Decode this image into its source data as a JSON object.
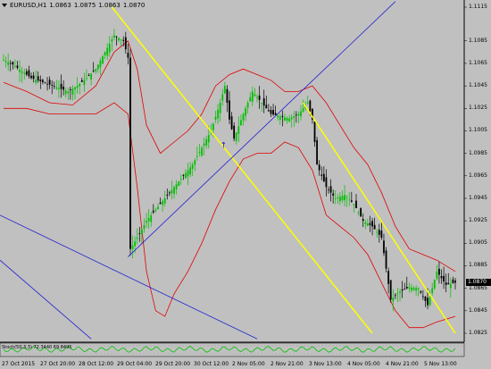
{
  "header": {
    "symbol": "EURUSD,H1",
    "open": "1.0863",
    "high": "1.0875",
    "low": "1.0863",
    "close": "1.0870"
  },
  "current_price": "1.0870",
  "oscillator_label": "Stoch(50,3,3) 72.3440 69.8495",
  "colors": {
    "background": "#c0c0c0",
    "bull": "#00c000",
    "bear": "#000000",
    "band": "#e00000",
    "trend_yellow": "#ffff00",
    "trend_blue": "#2020d0"
  },
  "chart_data": {
    "type": "candlestick",
    "ylim": [
      1.0825,
      1.1115
    ],
    "y_ticks": [
      "1.1115",
      "1.1085",
      "1.1065",
      "1.1045",
      "1.1025",
      "1.1005",
      "1.0985",
      "1.0965",
      "1.0945",
      "1.0925",
      "1.0905",
      "1.0885",
      "1.0865",
      "1.0845",
      "1.0825"
    ],
    "x_ticks": [
      "27 Oct 2015",
      "27 Oct 20:00",
      "28 Oct 12:00",
      "29 Oct 04:00",
      "29 Oct 20:00",
      "30 Oct 12:00",
      "2 Nov 05:00",
      "2 Nov 21:00",
      "3 Nov 13:00",
      "4 Nov 05:00",
      "4 Nov 21:00",
      "5 Nov 13:00"
    ],
    "close_path": [
      [
        0,
        1.1068
      ],
      [
        4,
        1.1064
      ],
      [
        8,
        1.1058
      ],
      [
        12,
        1.1052
      ],
      [
        16,
        1.1049
      ],
      [
        20,
        1.1046
      ],
      [
        24,
        1.1043
      ],
      [
        28,
        1.104
      ],
      [
        32,
        1.1045
      ],
      [
        36,
        1.1052
      ],
      [
        40,
        1.106
      ],
      [
        44,
        1.1075
      ],
      [
        48,
        1.109
      ],
      [
        52,
        1.1085
      ],
      [
        54,
        1.107
      ],
      [
        55,
        1.09
      ],
      [
        58,
        1.091
      ],
      [
        62,
        1.0925
      ],
      [
        66,
        1.0935
      ],
      [
        70,
        1.0945
      ],
      [
        74,
        1.0955
      ],
      [
        78,
        1.0965
      ],
      [
        82,
        1.0975
      ],
      [
        86,
        1.099
      ],
      [
        90,
        1.1005
      ],
      [
        94,
        1.103
      ],
      [
        96,
        1.1045
      ],
      [
        98,
        1.1015
      ],
      [
        100,
        1.0998
      ],
      [
        104,
        1.102
      ],
      [
        108,
        1.104
      ],
      [
        112,
        1.103
      ],
      [
        116,
        1.102
      ],
      [
        120,
        1.1018
      ],
      [
        124,
        1.1016
      ],
      [
        128,
        1.102
      ],
      [
        132,
        1.103
      ],
      [
        134,
        1.1015
      ],
      [
        136,
        1.0975
      ],
      [
        140,
        1.0955
      ],
      [
        144,
        1.0945
      ],
      [
        148,
        1.0948
      ],
      [
        152,
        1.094
      ],
      [
        156,
        1.0925
      ],
      [
        160,
        1.092
      ],
      [
        164,
        1.091
      ],
      [
        168,
        1.0855
      ],
      [
        172,
        1.0862
      ],
      [
        176,
        1.0866
      ],
      [
        180,
        1.0865
      ],
      [
        184,
        1.085
      ],
      [
        188,
        1.088
      ],
      [
        192,
        1.0868
      ],
      [
        196,
        1.087
      ]
    ],
    "upper_band": [
      [
        0,
        1.1048
      ],
      [
        10,
        1.104
      ],
      [
        20,
        1.103
      ],
      [
        30,
        1.1028
      ],
      [
        40,
        1.1045
      ],
      [
        48,
        1.1075
      ],
      [
        54,
        1.1085
      ],
      [
        58,
        1.106
      ],
      [
        62,
        1.101
      ],
      [
        68,
        1.0985
      ],
      [
        74,
        1.0995
      ],
      [
        80,
        1.1005
      ],
      [
        86,
        1.102
      ],
      [
        92,
        1.1045
      ],
      [
        98,
        1.1055
      ],
      [
        104,
        1.106
      ],
      [
        110,
        1.1055
      ],
      [
        116,
        1.105
      ],
      [
        122,
        1.104
      ],
      [
        128,
        1.104
      ],
      [
        134,
        1.1045
      ],
      [
        140,
        1.103
      ],
      [
        146,
        1.101
      ],
      [
        152,
        1.099
      ],
      [
        158,
        1.0975
      ],
      [
        164,
        1.095
      ],
      [
        170,
        1.092
      ],
      [
        176,
        1.09
      ],
      [
        182,
        1.0895
      ],
      [
        188,
        1.089
      ],
      [
        196,
        1.088
      ]
    ],
    "lower_band": [
      [
        0,
        1.1025
      ],
      [
        10,
        1.1025
      ],
      [
        20,
        1.102
      ],
      [
        30,
        1.102
      ],
      [
        40,
        1.102
      ],
      [
        48,
        1.103
      ],
      [
        54,
        1.102
      ],
      [
        58,
        1.0955
      ],
      [
        62,
        1.088
      ],
      [
        66,
        1.0845
      ],
      [
        70,
        1.084
      ],
      [
        74,
        1.086
      ],
      [
        80,
        1.088
      ],
      [
        86,
        1.0905
      ],
      [
        92,
        1.0935
      ],
      [
        98,
        1.096
      ],
      [
        104,
        1.098
      ],
      [
        110,
        1.0985
      ],
      [
        116,
        1.0985
      ],
      [
        122,
        1.0995
      ],
      [
        128,
        1.099
      ],
      [
        134,
        1.097
      ],
      [
        140,
        1.093
      ],
      [
        146,
        1.092
      ],
      [
        152,
        1.091
      ],
      [
        158,
        1.0895
      ],
      [
        164,
        1.087
      ],
      [
        170,
        1.0845
      ],
      [
        176,
        1.083
      ],
      [
        182,
        1.083
      ],
      [
        188,
        1.0835
      ],
      [
        196,
        1.084
      ]
    ]
  }
}
